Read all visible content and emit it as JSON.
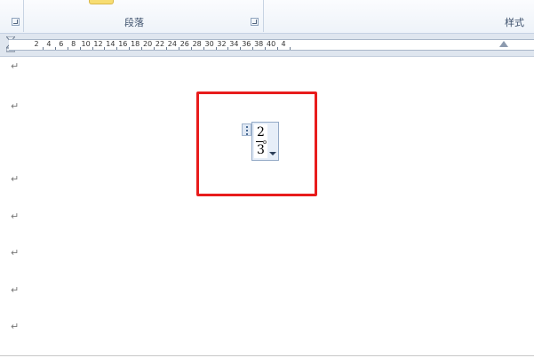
{
  "ribbon": {
    "paragraph_group_label": "段落",
    "styles_group_label": "样式"
  },
  "ruler": {
    "numbers": [
      "2",
      "4",
      "6",
      "8",
      "10",
      "12",
      "14",
      "16",
      "18",
      "20",
      "22",
      "24",
      "26",
      "28",
      "30",
      "32",
      "34",
      "36",
      "38",
      "40",
      "4"
    ]
  },
  "document": {
    "paragraph_mark": "↵",
    "equation": {
      "numerator": "2",
      "denominator": "3"
    }
  },
  "colors": {
    "highlight": "#e81c1c",
    "ribbon_bg": "#eef3f9",
    "ruler_bg": "#dfe6ef"
  },
  "icons": {
    "launcher": "dialog-launcher-icon",
    "dropdown": "chevron-down-icon",
    "handle": "drag-handle-icon"
  }
}
